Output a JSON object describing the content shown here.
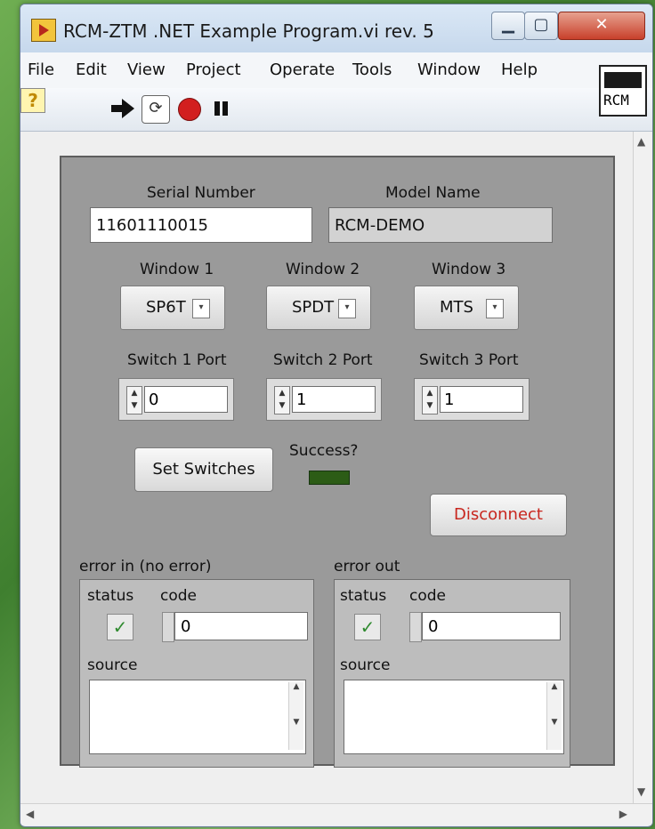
{
  "window": {
    "title": "RCM-ZTM .NET Example Program.vi rev. 5"
  },
  "menu": [
    "File",
    "Edit",
    "View",
    "Project",
    "Operate",
    "Tools",
    "Window",
    "Help"
  ],
  "logo_text": "RCM",
  "help_label": "?",
  "serial": {
    "label": "Serial Number",
    "value": "11601110015"
  },
  "model": {
    "label": "Model Name",
    "value": "RCM-DEMO"
  },
  "windows": [
    {
      "label": "Window 1",
      "value": "SP6T"
    },
    {
      "label": "Window 2",
      "value": "SPDT"
    },
    {
      "label": "Window 3",
      "value": "MTS"
    }
  ],
  "ports": [
    {
      "label": "Switch 1 Port",
      "value": "0"
    },
    {
      "label": "Switch 2 Port",
      "value": "1"
    },
    {
      "label": "Switch 3 Port",
      "value": "1"
    }
  ],
  "set_switches_label": "Set Switches",
  "success_label": "Success?",
  "disconnect_label": "Disconnect",
  "error_in": {
    "title": "error in (no error)",
    "status_label": "status",
    "code_label": "code",
    "code_value": "0",
    "source_label": "source"
  },
  "error_out": {
    "title": "error out",
    "status_label": "status",
    "code_label": "code",
    "code_value": "0",
    "source_label": "source"
  },
  "colors": {
    "disconnect_text": "#c8261e",
    "led_off": "#2c5c16",
    "check": "#2f8a2f"
  }
}
